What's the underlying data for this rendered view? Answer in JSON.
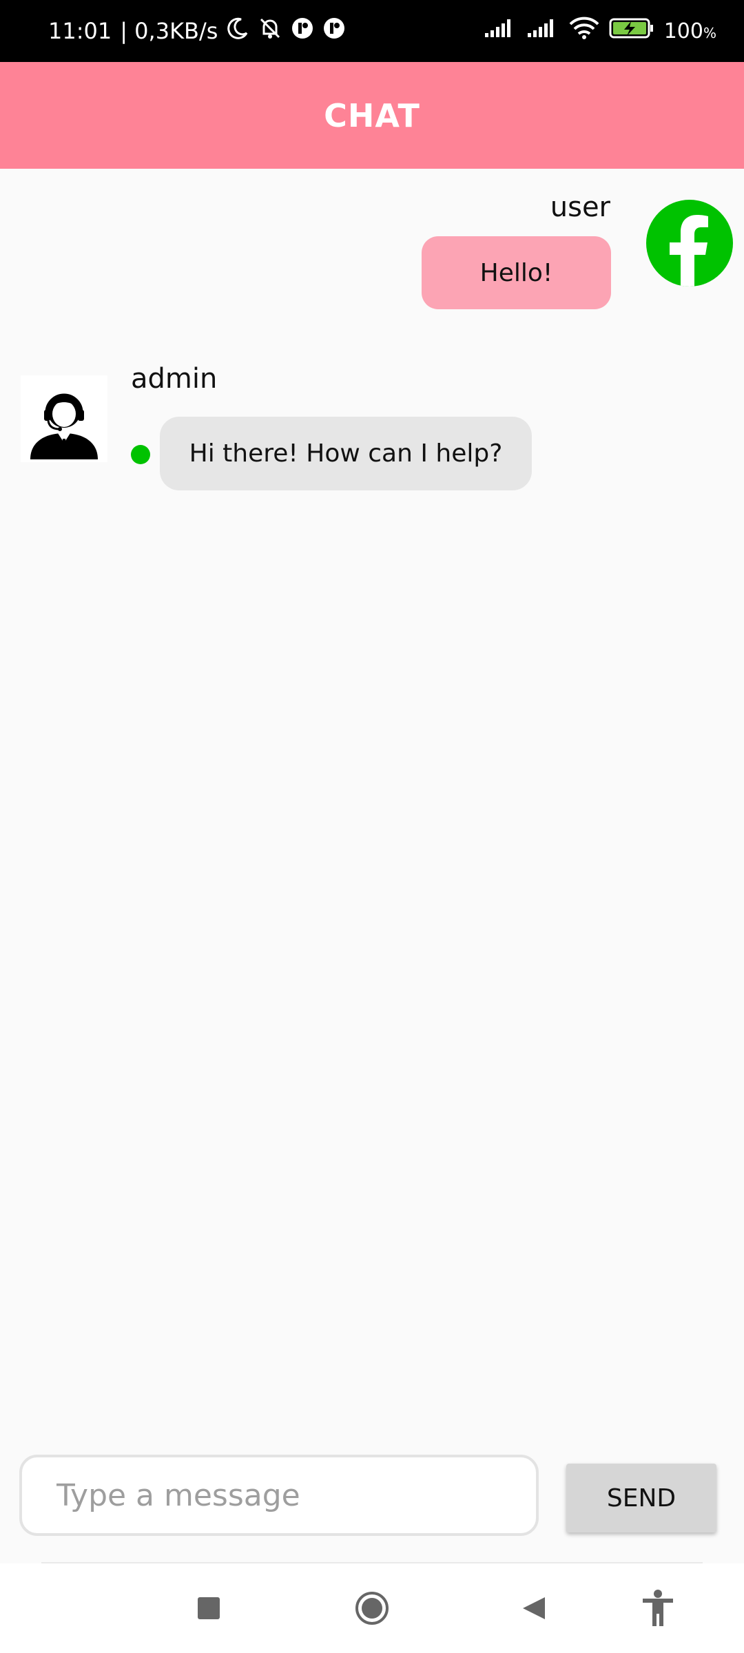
{
  "status_bar": {
    "time": "11:01",
    "network_speed": "| 0,3KB/s",
    "battery_percent": "100",
    "battery_unit": "%",
    "icons": [
      "moon-icon",
      "bell-off-icon",
      "app-notification-icon",
      "app-notification-icon",
      "signal-icon",
      "signal-icon",
      "wifi-icon",
      "battery-charging-icon"
    ]
  },
  "app_bar": {
    "title": "CHAT",
    "background": "#fe8396"
  },
  "messages": [
    {
      "sender": "user",
      "text": "Hello!",
      "avatar_icon": "facebook-icon",
      "bubble_color": "#fca4b4"
    },
    {
      "sender": "admin",
      "text": "Hi there! How can I help?",
      "avatar_icon": "support-agent-icon",
      "online": true,
      "bubble_color": "#e6e6e6"
    }
  ],
  "composer": {
    "placeholder": "Type a message",
    "value": "",
    "send_label": "SEND"
  },
  "nav_bar": {
    "items": [
      "recents-icon",
      "home-icon",
      "back-icon",
      "accessibility-icon"
    ]
  }
}
